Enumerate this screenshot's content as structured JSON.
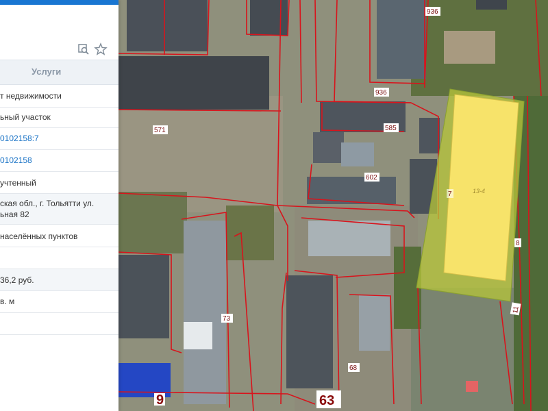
{
  "panel": {
    "tab_services": "Услуги",
    "tools": {
      "search_icon": "zoom-search-icon",
      "star_icon": "star-icon"
    },
    "rows": [
      {
        "text": "т недвижимости"
      },
      {
        "text": "ьный участок"
      },
      {
        "text": "0102158:7",
        "link": true
      },
      {
        "text": "0102158",
        "link": true
      },
      {
        "text": "учтенный"
      },
      {
        "line1": "ская обл., г. Тольятти ул.",
        "line2": "ьная 82"
      },
      {
        "text": "населённых пунктов"
      },
      {
        "text": ""
      },
      {
        "text": "36,2 руб."
      },
      {
        "text": "в. м"
      },
      {
        "text": ""
      }
    ]
  },
  "map": {
    "parcel_numbers": [
      "936",
      "936",
      "571",
      "585",
      "602",
      "7",
      "8",
      "11",
      "73",
      "68",
      "9",
      "63"
    ],
    "highlighted_parcel_label": "13-4"
  },
  "colors": {
    "accent": "#1976d2",
    "boundary": "#d8141c",
    "parcel_fill": "#f7e36a",
    "parcel_border": "#b7c53a"
  }
}
